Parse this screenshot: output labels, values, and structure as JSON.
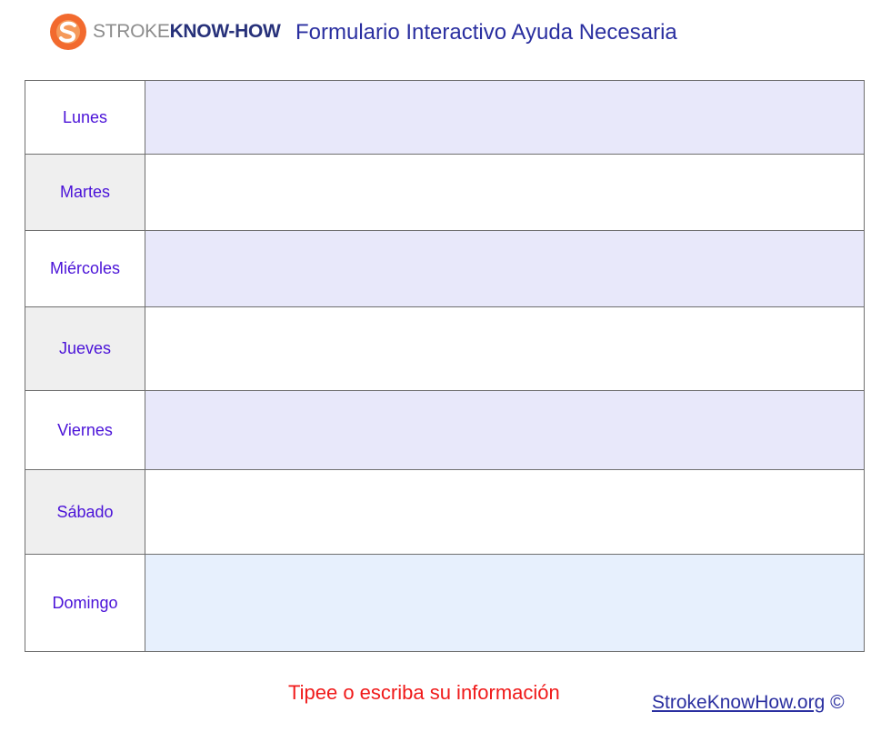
{
  "header": {
    "logo_stroke": "STROKE",
    "logo_knowhow": "KNOW-HOW",
    "title": "Formulario Interactivo Ayuda Necesaria"
  },
  "days": [
    {
      "label": "Lunes",
      "value": ""
    },
    {
      "label": "Martes",
      "value": ""
    },
    {
      "label": "Miércoles",
      "value": ""
    },
    {
      "label": "Jueves",
      "value": ""
    },
    {
      "label": "Viernes",
      "value": ""
    },
    {
      "label": "Sábado",
      "value": ""
    },
    {
      "label": "Domingo",
      "value": ""
    }
  ],
  "footer": {
    "instructions": "Tipee o escriba su información",
    "link_text": "StrokeKnowHow.org",
    "copyright": "©"
  },
  "colors": {
    "title_blue": "#2a2fa0",
    "day_label_purple": "#4a12d8",
    "instruction_red": "#f01a1a",
    "logo_orange": "#f26a2e",
    "logo_navy": "#27317a"
  }
}
